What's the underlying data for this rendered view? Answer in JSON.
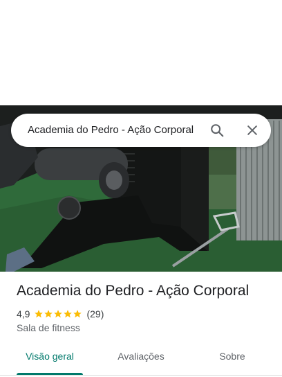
{
  "search": {
    "query": "Academia do Pedro - Ação Corporal",
    "search_icon": "search-icon",
    "close_icon": "close-icon"
  },
  "place": {
    "title": "Academia do Pedro - Ação Corporal",
    "rating": "4,9",
    "stars": 5,
    "review_count": "(29)",
    "category": "Sala de fitness"
  },
  "tabs": [
    {
      "label": "Visão geral",
      "active": true
    },
    {
      "label": "Avaliações",
      "active": false
    },
    {
      "label": "Sobre",
      "active": false
    }
  ],
  "colors": {
    "accent": "#00796b",
    "star": "#fbbc04",
    "icon": "#5f6368"
  }
}
